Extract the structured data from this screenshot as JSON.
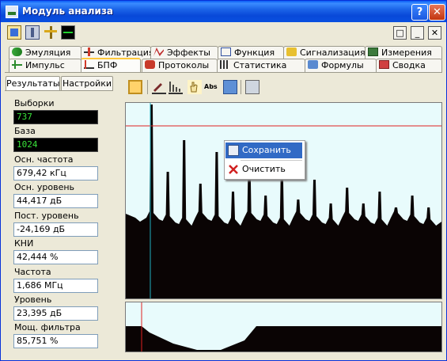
{
  "window": {
    "title": "Модуль анализа",
    "help": "?",
    "close": "✕"
  },
  "win_controls": [
    "□",
    "_",
    "✕"
  ],
  "tabs_row1": [
    "Эмуляция",
    "Фильтрация",
    "Эффекты",
    "Функция",
    "Сигнализация",
    "Измерения"
  ],
  "tabs_row2": [
    "Импульс",
    "БПФ",
    "Протоколы",
    "Статистика",
    "Формулы",
    "Сводка"
  ],
  "selected_tab": "БПФ",
  "left_tabs": [
    "Результаты",
    "Настройки"
  ],
  "fields": [
    {
      "label": "Выборки",
      "value": "737",
      "dark": true
    },
    {
      "label": "База",
      "value": "1024",
      "dark": true
    },
    {
      "label": "Осн. частота",
      "value": "679,42 кГц",
      "dark": false
    },
    {
      "label": "Осн. уровень",
      "value": "44,417 дБ",
      "dark": false
    },
    {
      "label": "Пост. уровень",
      "value": "-24,169 дБ",
      "dark": false
    },
    {
      "label": "КНИ",
      "value": "42,444 %",
      "dark": false
    },
    {
      "label": "Частота",
      "value": "1,686 МГц",
      "dark": false
    },
    {
      "label": "Уровень",
      "value": "23,395 дБ",
      "dark": false
    },
    {
      "label": "Мощ. фильтра",
      "value": "85,751 %",
      "dark": false
    }
  ],
  "chart_toolbar": {
    "abs_label": "Abs"
  },
  "context_menu": {
    "save": "Сохранить",
    "clear": "Очистить"
  },
  "colors": {
    "accent": "#316ac5",
    "titlebar": "#0a5cf6",
    "plot_bg": "#e8fbfc",
    "cursor_red": "#e02020",
    "cursor_cyan": "#20b0c0"
  }
}
